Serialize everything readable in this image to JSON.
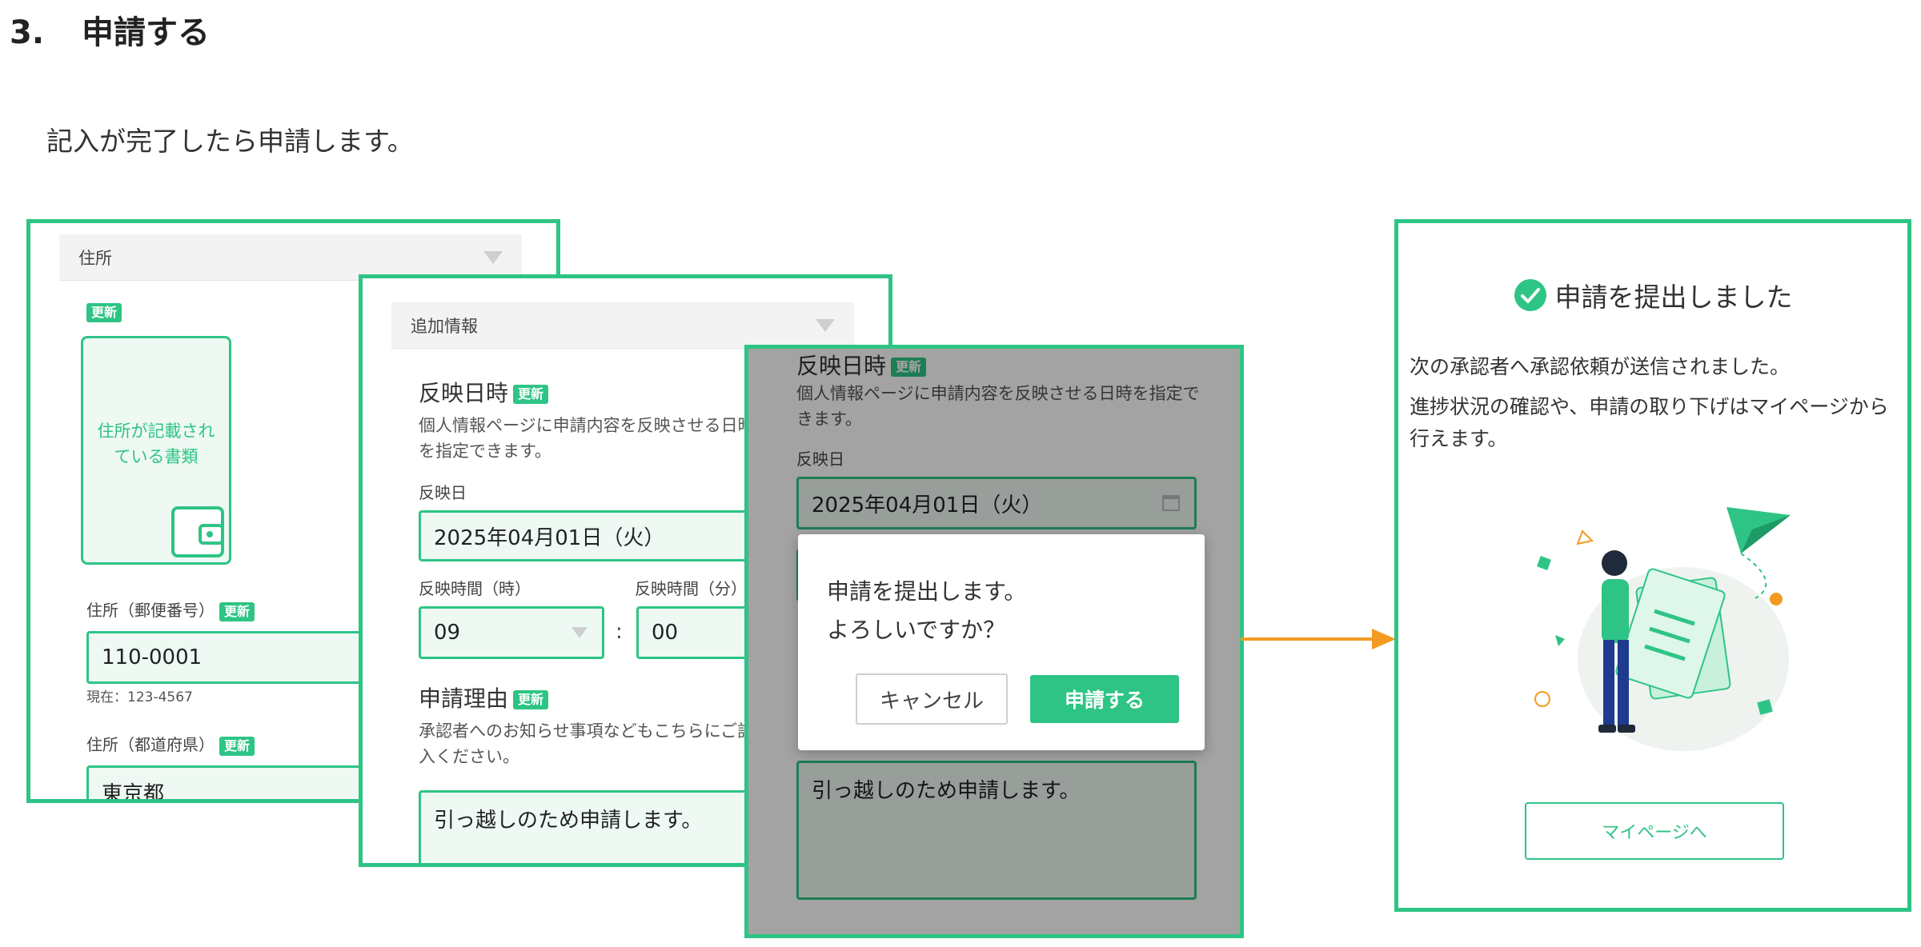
{
  "heading": {
    "number": "3.",
    "title": "申請する"
  },
  "intro": "記入が完了したら申請します。",
  "screen1": {
    "section_title": "住所",
    "badge": "更新",
    "document_card": "住所が記載されている書類",
    "postal_label": "住所（郵便番号）",
    "postal_value": "110-0001",
    "postal_current": "現在：123-4567",
    "pref_label": "住所（都道府県）",
    "pref_value": "東京都"
  },
  "screen2": {
    "section_title": "追加情報",
    "badge": "更新",
    "reflect_title": "反映日時",
    "reflect_desc": "個人情報ページに申請内容を反映させる日時を指定できます。",
    "date_label": "反映日",
    "date_value": "2025年04月01日（火）",
    "hour_label": "反映時間（時）",
    "hour_value": "09",
    "minute_label": "反映時間（分）",
    "minute_value": "00",
    "colon": ":",
    "reason_title": "申請理由",
    "reason_desc": "承認者へのお知らせ事項などもこちらにご記入ください。",
    "reason_value": "引っ越しのため申請します。"
  },
  "screen3": {
    "reflect_title": "反映日時",
    "badge": "更新",
    "reflect_desc": "個人情報ページに申請内容を反映させる日時を指定できます。",
    "date_label": "反映日",
    "date_value": "2025年04月01日（火）",
    "reason_value": "引っ越しのため申請します。",
    "dialog": {
      "line1": "申請を提出します。",
      "line2": "よろしいですか？",
      "cancel": "キャンセル",
      "submit": "申請する"
    }
  },
  "screen4": {
    "title": "申請を提出しました",
    "message1": "次の承認者へ承認依頼が送信されました。",
    "message2": "進捗状況の確認や、申請の取り下げはマイページから行えます。",
    "button": "マイページへ"
  },
  "colors": {
    "accent": "#2ec485",
    "arrow": "#f39a22"
  }
}
